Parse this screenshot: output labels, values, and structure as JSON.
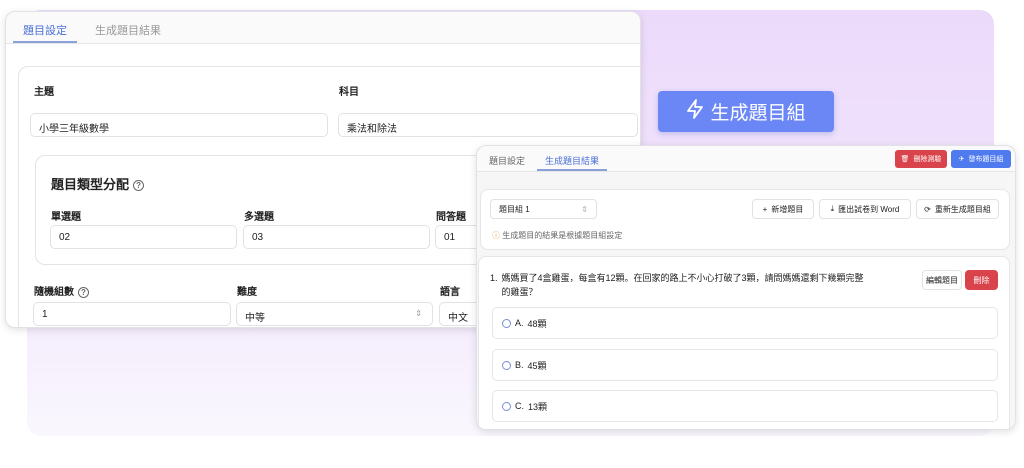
{
  "generate_button": {
    "label": "生成題目組",
    "icon": "lightning-icon"
  },
  "left_panel": {
    "tabs": [
      "題目設定",
      "生成題目結果"
    ],
    "topic": {
      "label": "主題",
      "value": "小學三年級數學"
    },
    "subject": {
      "label": "科目",
      "value": "乘法和除法"
    },
    "type_distribution": {
      "title": "題目類型分配",
      "fields": [
        {
          "label": "單選題",
          "value": "02"
        },
        {
          "label": "多選題",
          "value": "03"
        },
        {
          "label": "問答題",
          "value": "01"
        }
      ]
    },
    "random_sets": {
      "label": "隨機組數",
      "value": "1"
    },
    "difficulty": {
      "label": "難度",
      "value": "中等"
    },
    "language": {
      "label": "語言",
      "value": "中文"
    }
  },
  "right_panel": {
    "tabs": [
      "題目設定",
      "生成題目結果"
    ],
    "delete_exam": "刪除測驗",
    "publish": "發布題目組",
    "set_select": "題目組 1",
    "add_question": "新增題目",
    "export_word": "匯出試卷到 Word",
    "regenerate": "重新生成題目組",
    "notice": "生成題目的結果是根據題目組設定",
    "question": {
      "number": "1.",
      "text": "媽媽買了4盒雞蛋，每盒有12顆。在回家的路上不小心打破了3顆，請問媽媽還剩下幾顆完整的雞蛋？",
      "edit": "編輯題目",
      "delete": "刪除",
      "options": [
        {
          "letter": "A.",
          "text": "48顆"
        },
        {
          "letter": "B.",
          "text": "45顆"
        },
        {
          "letter": "C.",
          "text": "13顆"
        }
      ]
    }
  },
  "colors": {
    "accent": "#6b87f5",
    "danger": "#d9434b",
    "publish": "#4f7bee"
  }
}
